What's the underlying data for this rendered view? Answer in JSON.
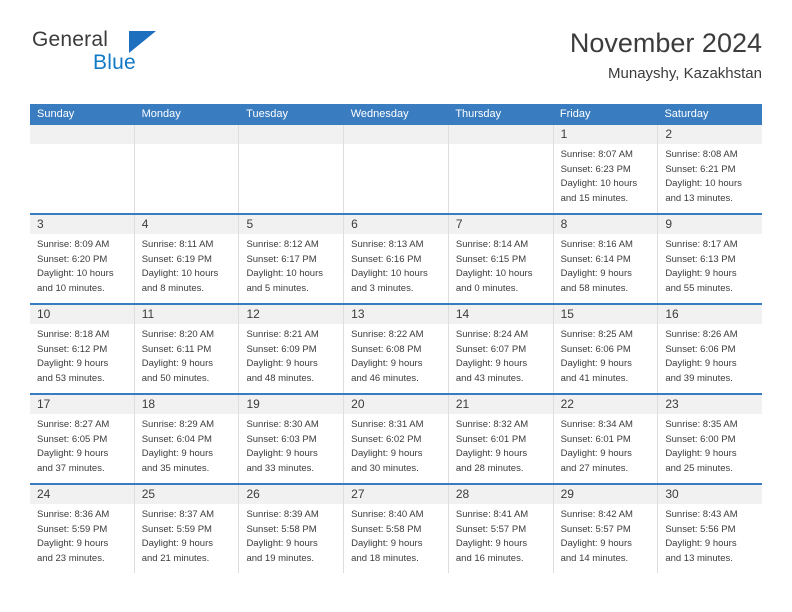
{
  "brand": {
    "name_part1": "General",
    "name_part2": "Blue",
    "triangle_icon": "triangle-icon",
    "accent_color": "#1279c6",
    "header_color": "#3a7cc0"
  },
  "header": {
    "title": "November 2024",
    "subtitle": "Munayshy, Kazakhstan"
  },
  "calendar": {
    "weekdays": [
      "Sunday",
      "Monday",
      "Tuesday",
      "Wednesday",
      "Thursday",
      "Friday",
      "Saturday"
    ],
    "weeks": [
      [
        {
          "day": "",
          "lines": []
        },
        {
          "day": "",
          "lines": []
        },
        {
          "day": "",
          "lines": []
        },
        {
          "day": "",
          "lines": []
        },
        {
          "day": "",
          "lines": []
        },
        {
          "day": "1",
          "lines": [
            "Sunrise: 8:07 AM",
            "Sunset: 6:23 PM",
            "Daylight: 10 hours",
            "and 15 minutes."
          ]
        },
        {
          "day": "2",
          "lines": [
            "Sunrise: 8:08 AM",
            "Sunset: 6:21 PM",
            "Daylight: 10 hours",
            "and 13 minutes."
          ]
        }
      ],
      [
        {
          "day": "3",
          "lines": [
            "Sunrise: 8:09 AM",
            "Sunset: 6:20 PM",
            "Daylight: 10 hours",
            "and 10 minutes."
          ]
        },
        {
          "day": "4",
          "lines": [
            "Sunrise: 8:11 AM",
            "Sunset: 6:19 PM",
            "Daylight: 10 hours",
            "and 8 minutes."
          ]
        },
        {
          "day": "5",
          "lines": [
            "Sunrise: 8:12 AM",
            "Sunset: 6:17 PM",
            "Daylight: 10 hours",
            "and 5 minutes."
          ]
        },
        {
          "day": "6",
          "lines": [
            "Sunrise: 8:13 AM",
            "Sunset: 6:16 PM",
            "Daylight: 10 hours",
            "and 3 minutes."
          ]
        },
        {
          "day": "7",
          "lines": [
            "Sunrise: 8:14 AM",
            "Sunset: 6:15 PM",
            "Daylight: 10 hours",
            "and 0 minutes."
          ]
        },
        {
          "day": "8",
          "lines": [
            "Sunrise: 8:16 AM",
            "Sunset: 6:14 PM",
            "Daylight: 9 hours",
            "and 58 minutes."
          ]
        },
        {
          "day": "9",
          "lines": [
            "Sunrise: 8:17 AM",
            "Sunset: 6:13 PM",
            "Daylight: 9 hours",
            "and 55 minutes."
          ]
        }
      ],
      [
        {
          "day": "10",
          "lines": [
            "Sunrise: 8:18 AM",
            "Sunset: 6:12 PM",
            "Daylight: 9 hours",
            "and 53 minutes."
          ]
        },
        {
          "day": "11",
          "lines": [
            "Sunrise: 8:20 AM",
            "Sunset: 6:11 PM",
            "Daylight: 9 hours",
            "and 50 minutes."
          ]
        },
        {
          "day": "12",
          "lines": [
            "Sunrise: 8:21 AM",
            "Sunset: 6:09 PM",
            "Daylight: 9 hours",
            "and 48 minutes."
          ]
        },
        {
          "day": "13",
          "lines": [
            "Sunrise: 8:22 AM",
            "Sunset: 6:08 PM",
            "Daylight: 9 hours",
            "and 46 minutes."
          ]
        },
        {
          "day": "14",
          "lines": [
            "Sunrise: 8:24 AM",
            "Sunset: 6:07 PM",
            "Daylight: 9 hours",
            "and 43 minutes."
          ]
        },
        {
          "day": "15",
          "lines": [
            "Sunrise: 8:25 AM",
            "Sunset: 6:06 PM",
            "Daylight: 9 hours",
            "and 41 minutes."
          ]
        },
        {
          "day": "16",
          "lines": [
            "Sunrise: 8:26 AM",
            "Sunset: 6:06 PM",
            "Daylight: 9 hours",
            "and 39 minutes."
          ]
        }
      ],
      [
        {
          "day": "17",
          "lines": [
            "Sunrise: 8:27 AM",
            "Sunset: 6:05 PM",
            "Daylight: 9 hours",
            "and 37 minutes."
          ]
        },
        {
          "day": "18",
          "lines": [
            "Sunrise: 8:29 AM",
            "Sunset: 6:04 PM",
            "Daylight: 9 hours",
            "and 35 minutes."
          ]
        },
        {
          "day": "19",
          "lines": [
            "Sunrise: 8:30 AM",
            "Sunset: 6:03 PM",
            "Daylight: 9 hours",
            "and 33 minutes."
          ]
        },
        {
          "day": "20",
          "lines": [
            "Sunrise: 8:31 AM",
            "Sunset: 6:02 PM",
            "Daylight: 9 hours",
            "and 30 minutes."
          ]
        },
        {
          "day": "21",
          "lines": [
            "Sunrise: 8:32 AM",
            "Sunset: 6:01 PM",
            "Daylight: 9 hours",
            "and 28 minutes."
          ]
        },
        {
          "day": "22",
          "lines": [
            "Sunrise: 8:34 AM",
            "Sunset: 6:01 PM",
            "Daylight: 9 hours",
            "and 27 minutes."
          ]
        },
        {
          "day": "23",
          "lines": [
            "Sunrise: 8:35 AM",
            "Sunset: 6:00 PM",
            "Daylight: 9 hours",
            "and 25 minutes."
          ]
        }
      ],
      [
        {
          "day": "24",
          "lines": [
            "Sunrise: 8:36 AM",
            "Sunset: 5:59 PM",
            "Daylight: 9 hours",
            "and 23 minutes."
          ]
        },
        {
          "day": "25",
          "lines": [
            "Sunrise: 8:37 AM",
            "Sunset: 5:59 PM",
            "Daylight: 9 hours",
            "and 21 minutes."
          ]
        },
        {
          "day": "26",
          "lines": [
            "Sunrise: 8:39 AM",
            "Sunset: 5:58 PM",
            "Daylight: 9 hours",
            "and 19 minutes."
          ]
        },
        {
          "day": "27",
          "lines": [
            "Sunrise: 8:40 AM",
            "Sunset: 5:58 PM",
            "Daylight: 9 hours",
            "and 18 minutes."
          ]
        },
        {
          "day": "28",
          "lines": [
            "Sunrise: 8:41 AM",
            "Sunset: 5:57 PM",
            "Daylight: 9 hours",
            "and 16 minutes."
          ]
        },
        {
          "day": "29",
          "lines": [
            "Sunrise: 8:42 AM",
            "Sunset: 5:57 PM",
            "Daylight: 9 hours",
            "and 14 minutes."
          ]
        },
        {
          "day": "30",
          "lines": [
            "Sunrise: 8:43 AM",
            "Sunset: 5:56 PM",
            "Daylight: 9 hours",
            "and 13 minutes."
          ]
        }
      ]
    ]
  }
}
